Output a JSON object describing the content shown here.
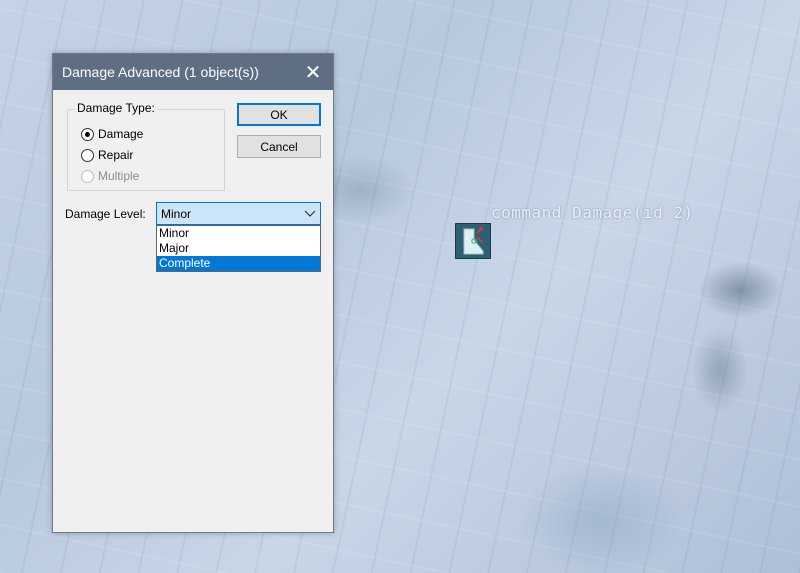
{
  "map": {
    "unit_label": "command Damage(id 2)",
    "unit_icon": "unit-marker-icon"
  },
  "dialog": {
    "title": "Damage Advanced (1 object(s))",
    "close_symbol": "✕",
    "damage_type": {
      "legend": "Damage Type:",
      "options": [
        {
          "label": "Damage",
          "checked": true,
          "enabled": true
        },
        {
          "label": "Repair",
          "checked": false,
          "enabled": true
        },
        {
          "label": "Multiple",
          "checked": false,
          "enabled": false
        }
      ]
    },
    "ok_label": "OK",
    "cancel_label": "Cancel",
    "damage_level": {
      "label": "Damage Level:",
      "value": "Minor",
      "options": [
        "Minor",
        "Major",
        "Complete"
      ],
      "highlighted": "Complete"
    }
  },
  "colors": {
    "titlebar": "#5e6e83",
    "accent": "#0078d7",
    "unit_marker": "#2f5f73"
  }
}
